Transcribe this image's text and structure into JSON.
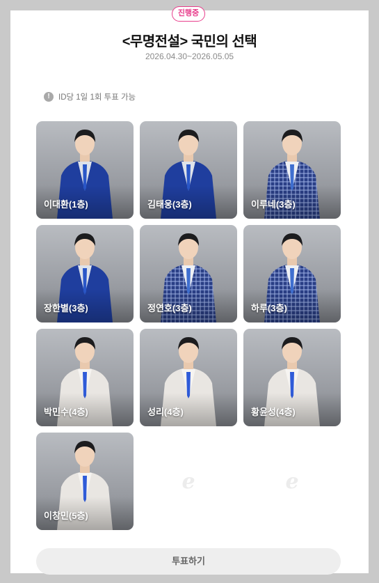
{
  "header": {
    "status_badge": "진행중",
    "title": "<무명전설> 국민의 선택",
    "period": "2026.04.30~2026.05.05"
  },
  "notice": {
    "icon": "info-icon",
    "icon_glyph": "!",
    "text": "ID당 1일 1회 투표 가능"
  },
  "candidates": [
    {
      "name": "이대환(1층)",
      "outfit": "blue-velvet"
    },
    {
      "name": "김태웅(3층)",
      "outfit": "blue-velvet"
    },
    {
      "name": "이루네(3층)",
      "outfit": "blue-check"
    },
    {
      "name": "장한별(3층)",
      "outfit": "blue-velvet"
    },
    {
      "name": "정연호(3층)",
      "outfit": "blue-check"
    },
    {
      "name": "하루(3층)",
      "outfit": "blue-check"
    },
    {
      "name": "박민수(4층)",
      "outfit": "white-suit"
    },
    {
      "name": "성리(4층)",
      "outfit": "white-suit"
    },
    {
      "name": "황윤성(4층)",
      "outfit": "white-suit"
    },
    {
      "name": "이창민(5층)",
      "outfit": "white-suit"
    }
  ],
  "empty_slot_glyph": "e",
  "vote_button_label": "투표하기",
  "colors": {
    "accent_pink": "#e83e8c",
    "velvet_blue": "#1f3e9e",
    "check_blue": "#2a3f86",
    "white_suit": "#e9e6e2",
    "card_bg": "#9da0a6"
  }
}
